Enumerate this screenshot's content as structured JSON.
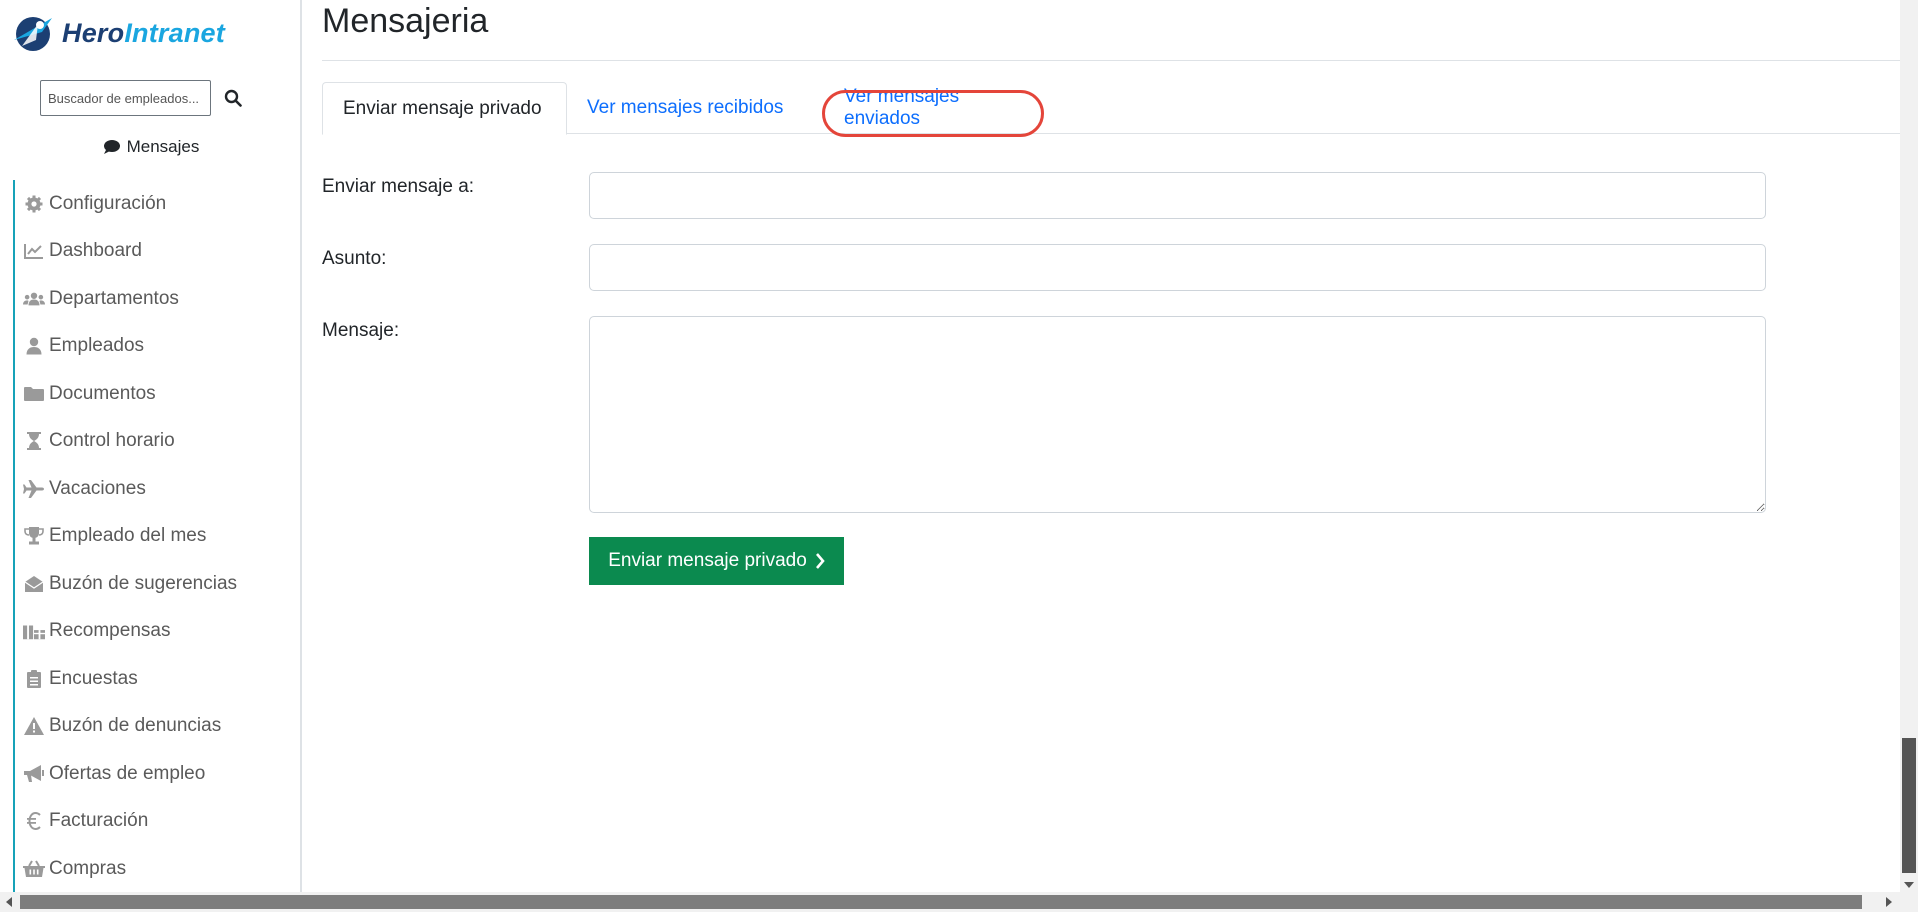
{
  "brand": {
    "part1": "Hero",
    "part2": "Intranet"
  },
  "sidebar": {
    "search_placeholder": "Buscador de empleados...",
    "messages_label": "Mensajes",
    "items": [
      {
        "label": "Configuración",
        "icon": "gear-icon"
      },
      {
        "label": "Dashboard",
        "icon": "chart-line-icon"
      },
      {
        "label": "Departamentos",
        "icon": "users-icon"
      },
      {
        "label": "Empleados",
        "icon": "user-icon"
      },
      {
        "label": "Documentos",
        "icon": "folder-icon"
      },
      {
        "label": "Control horario",
        "icon": "hourglass-icon"
      },
      {
        "label": "Vacaciones",
        "icon": "plane-icon"
      },
      {
        "label": "Empleado del mes",
        "icon": "trophy-icon"
      },
      {
        "label": "Buzón de sugerencias",
        "icon": "envelope-open-icon"
      },
      {
        "label": "Recompensas",
        "icon": "gifts-icon"
      },
      {
        "label": "Encuestas",
        "icon": "clipboard-list-icon"
      },
      {
        "label": "Buzón de denuncias",
        "icon": "warning-icon"
      },
      {
        "label": "Ofertas de empleo",
        "icon": "megaphone-icon"
      },
      {
        "label": "Facturación",
        "icon": "euro-icon"
      },
      {
        "label": "Compras",
        "icon": "basket-icon"
      }
    ]
  },
  "main": {
    "title": "Mensajeria",
    "tabs": [
      {
        "label": "Enviar mensaje privado",
        "active": true
      },
      {
        "label": "Ver mensajes recibidos",
        "active": false
      },
      {
        "label": "Ver mensajes enviados",
        "active": false,
        "highlighted": true
      }
    ],
    "form": {
      "to_label": "Enviar mensaje a:",
      "to_value": "",
      "subject_label": "Asunto:",
      "subject_value": "",
      "message_label": "Mensaje:",
      "message_value": "",
      "submit_label": "Enviar mensaje privado"
    }
  },
  "colors": {
    "accent_link": "#0d6efd",
    "submit_bg": "#0b8a4f",
    "highlight": "#e4453a",
    "sidebar_rule": "#17a2b8",
    "brand_dark": "#1c3f73",
    "brand_light": "#1aa6e0"
  }
}
